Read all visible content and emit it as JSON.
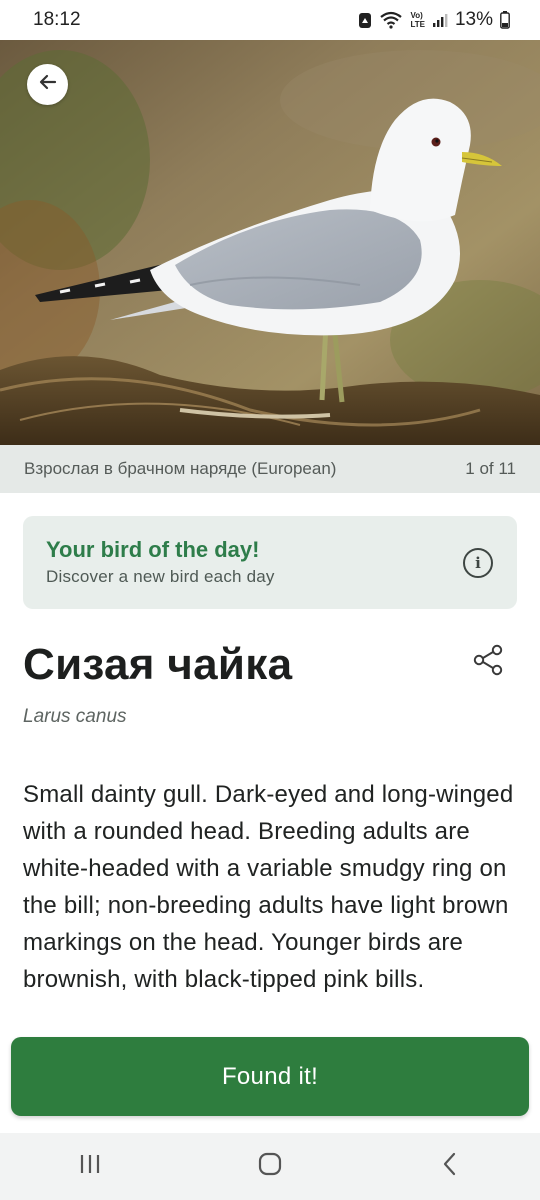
{
  "status_bar": {
    "time": "18:12",
    "battery": "13%",
    "network_label_top": "Vo)",
    "network_label_bottom": "LTE"
  },
  "hero": {
    "image_alt": "Common gull standing on twigs",
    "caption": "Взрослая в брачном наряде (European)",
    "counter": "1 of 11"
  },
  "daily_card": {
    "title": "Your bird of the day!",
    "subtitle": "Discover a new bird each day",
    "info_icon": "i"
  },
  "species": {
    "common_name": "Сизая чайка",
    "scientific_name": "Larus canus",
    "description": "Small dainty gull. Dark-eyed and long-winged with a rounded head. Breeding adults are white-headed with a variable smudgy ring on the bill; non-breeding adults have light brown markings on the head. Younger birds are brownish, with black-tipped pink bills."
  },
  "actions": {
    "found_label": "Found it!"
  },
  "colors": {
    "accent_green": "#2e7d3e",
    "title_green": "#2e7d4a",
    "card_bg": "#e8eeeb",
    "caption_bg": "#e5e9e7"
  },
  "icons": {
    "back": "arrow-left-icon",
    "share": "share-icon",
    "info": "info-icon",
    "nav_recents": "recents-icon",
    "nav_home": "home-icon",
    "nav_back": "chevron-left-icon"
  }
}
